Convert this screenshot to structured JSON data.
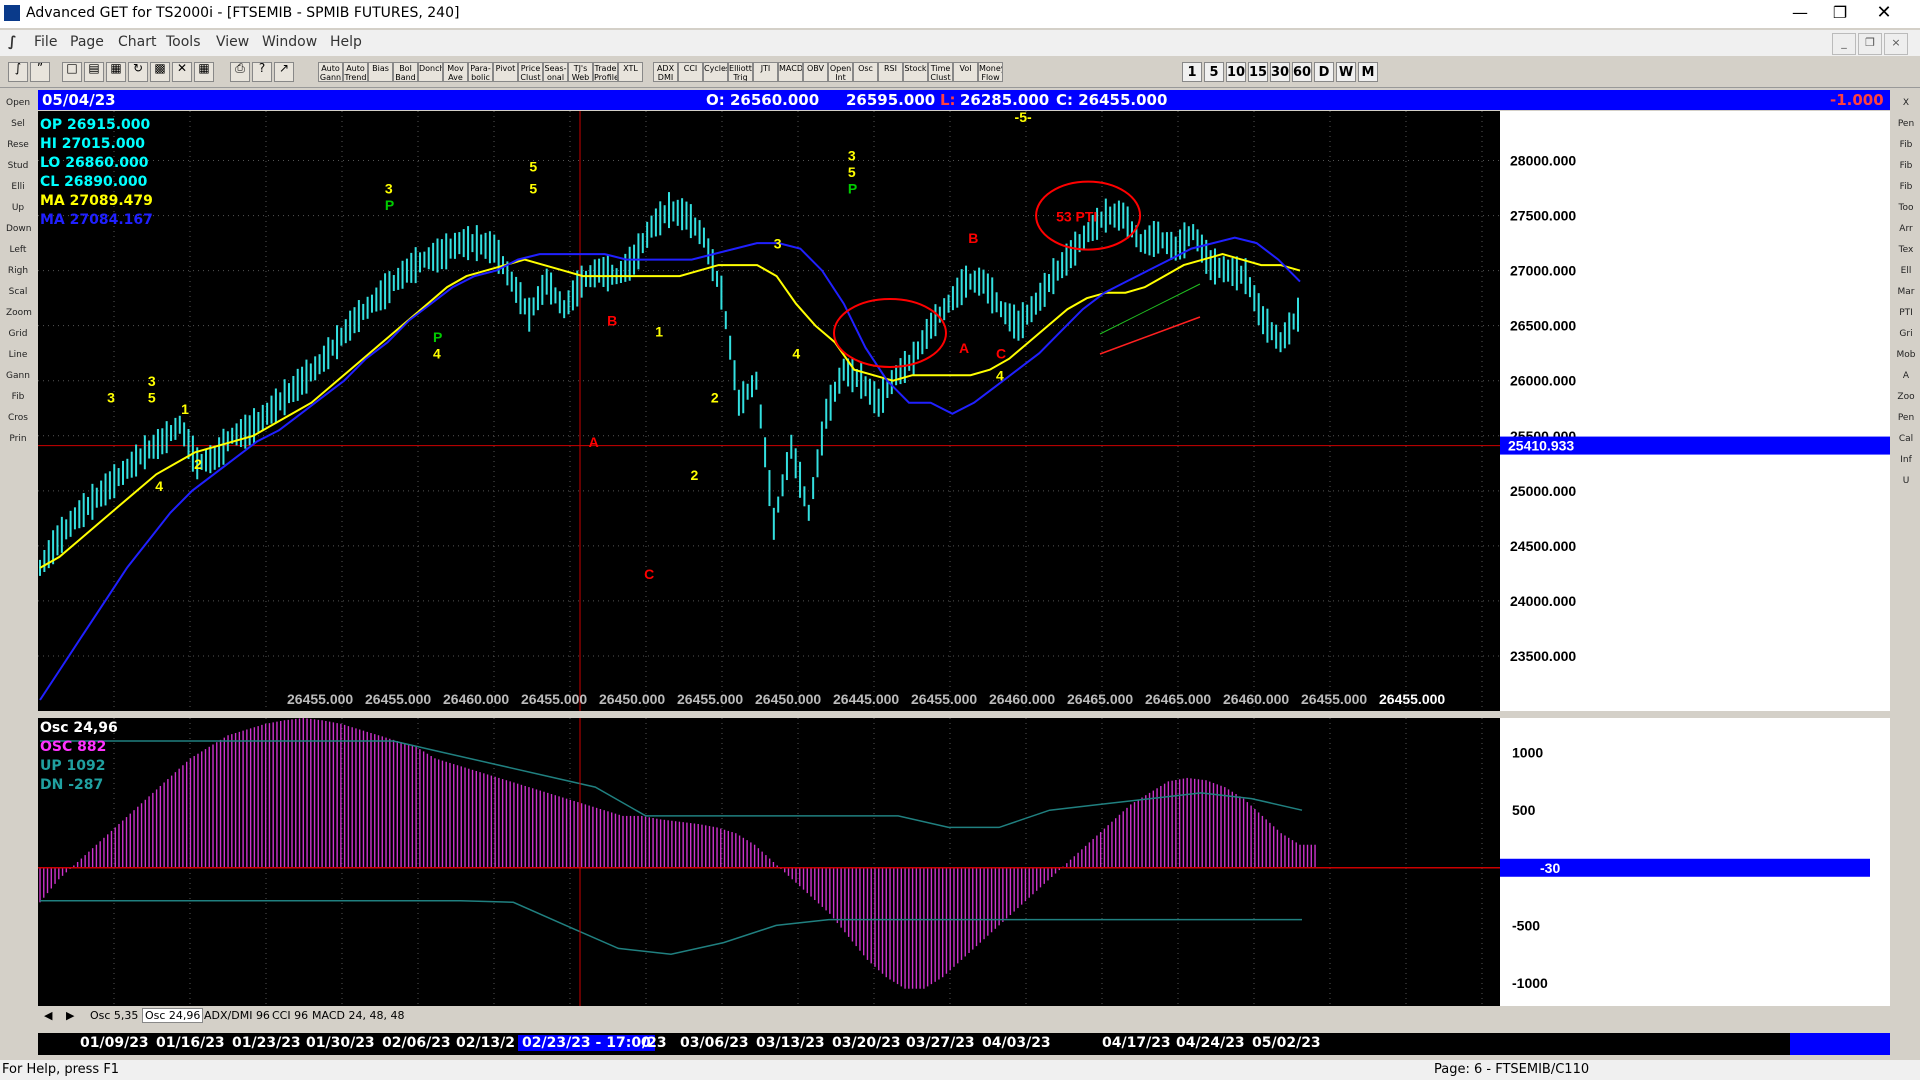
{
  "window": {
    "title": "Advanced GET for TS2000i - [FTSEMIB - SPMIB FUTURES, 240]"
  },
  "menu": [
    "File",
    "Page",
    "Chart",
    "Tools",
    "View",
    "Window",
    "Help"
  ],
  "toolbar": {
    "study_buttons": [
      "Auto Gann",
      "Auto Trend",
      "Bias",
      "Bol Band",
      "Donch",
      "Mov Ave",
      "Para-bolic",
      "Pivot",
      "Price Clust",
      "Seas-onal",
      "TJ's Web",
      "Trade Profile",
      "XTL",
      "ADX DMI",
      "CCI",
      "Cycles",
      "Elliott Trig",
      "JTI",
      "MACD",
      "OBV",
      "Open Int",
      "Osc",
      "RSI",
      "Stock",
      "Time Clust",
      "Vol",
      "Money Flow"
    ],
    "timeframes": [
      "1",
      "5",
      "10",
      "15",
      "30",
      "60",
      "D",
      "W",
      "M"
    ]
  },
  "info_bar": {
    "date": "05/04/23",
    "open": "O: 26560.000",
    "high": "26595.000",
    "low_label": "L:",
    "low": "26285.000",
    "close": "C: 26455.000",
    "change": "-1.000"
  },
  "chart_data": [
    {
      "type": "line",
      "title": "",
      "price_axis_ticks": [
        "28000.000",
        "27500.000",
        "27000.000",
        "26500.000",
        "26000.000",
        "25500.000",
        "25000.000",
        "24500.000",
        "24000.000",
        "23500.000"
      ],
      "ylim": [
        23000,
        28450
      ],
      "cursor_price": "25410.933",
      "cursor_price_value": 25410.933,
      "overlay": {
        "op": "OP  26915.000",
        "hi": "HI   27015.000",
        "lo": "LO   26860.000",
        "cl": "CL   26890.000",
        "ma1": "MA  27089.479",
        "ma2": "MA  27084.167"
      },
      "bottom_values": [
        "26455.000",
        "26455.000",
        "26460.000",
        "26455.000",
        "26450.000",
        "26455.000",
        "26450.000",
        "26445.000",
        "26455.000",
        "26460.000",
        "26465.000",
        "26465.000",
        "26460.000",
        "26455.000",
        "26455.000"
      ],
      "price_series": {
        "name": "",
        "values": [
          24300,
          24550,
          24750,
          24900,
          25050,
          25200,
          25350,
          25450,
          25600,
          25250,
          25300,
          25500,
          25550,
          25700,
          25850,
          26000,
          26150,
          26350,
          26550,
          26700,
          26850,
          27000,
          27100,
          27150,
          27250,
          27250,
          27200,
          26900,
          26600,
          26900,
          26650,
          26900,
          27000,
          26950,
          27100,
          27400,
          27550,
          27500,
          27300,
          26800,
          25800,
          26000,
          24700,
          25400,
          24800,
          25700,
          26100,
          26000,
          25800,
          26050,
          26200,
          26500,
          26700,
          26900,
          26900,
          26650,
          26500,
          26700,
          26950,
          27150,
          27350,
          27500,
          27500,
          27250,
          27300,
          27200,
          27350,
          27050,
          27000,
          26950,
          26550,
          26350,
          26600
        ]
      },
      "ma_yellow": {
        "name": "",
        "values": [
          24300,
          24400,
          24550,
          24700,
          24850,
          25000,
          25150,
          25250,
          25350,
          25400,
          25450,
          25500,
          25600,
          25700,
          25800,
          25950,
          26100,
          26250,
          26400,
          26550,
          26700,
          26850,
          26950,
          27000,
          27050,
          27100,
          27050,
          27000,
          26950,
          26950,
          26950,
          26950,
          26950,
          26950,
          27000,
          27050,
          27050,
          27050,
          26950,
          26700,
          26500,
          26350,
          26100,
          26050,
          26000,
          26050,
          26050,
          26050,
          26050,
          26100,
          26200,
          26350,
          26500,
          26650,
          26750,
          26800,
          26800,
          26850,
          26950,
          27050,
          27100,
          27150,
          27100,
          27050,
          27050,
          27000
        ]
      },
      "ma_blue": {
        "name": "",
        "values": [
          23100,
          23400,
          23700,
          24000,
          24300,
          24550,
          24800,
          25000,
          25150,
          25300,
          25450,
          25550,
          25700,
          25850,
          26000,
          26200,
          26350,
          26550,
          26700,
          26850,
          26950,
          27000,
          27100,
          27150,
          27150,
          27150,
          27150,
          27100,
          27100,
          27100,
          27100,
          27150,
          27200,
          27250,
          27250,
          27200,
          27000,
          26700,
          26300,
          26000,
          25800,
          25800,
          25700,
          25800,
          25950,
          26100,
          26250,
          26450,
          26650,
          26800,
          26900,
          27000,
          27100,
          27200,
          27250,
          27300,
          27250,
          27100,
          26900
        ]
      },
      "labels": [
        {
          "text": "3",
          "color": "#ffff00",
          "x": 0.04,
          "y": 25800
        },
        {
          "text": "3",
          "color": "#ffff00",
          "x": 0.062,
          "y": 25950
        },
        {
          "text": "5",
          "color": "#ffff00",
          "x": 0.062,
          "y": 25800
        },
        {
          "text": "4",
          "color": "#ffff00",
          "x": 0.066,
          "y": 25000
        },
        {
          "text": "1",
          "color": "#ffff00",
          "x": 0.08,
          "y": 25700
        },
        {
          "text": "2",
          "color": "#ffff00",
          "x": 0.087,
          "y": 25200
        },
        {
          "text": "3",
          "color": "#ffff00",
          "x": 0.19,
          "y": 27700
        },
        {
          "text": "P",
          "color": "#00cc00",
          "x": 0.19,
          "y": 27550
        },
        {
          "text": "P",
          "color": "#00cc00",
          "x": 0.216,
          "y": 26350
        },
        {
          "text": "4",
          "color": "#ffff00",
          "x": 0.216,
          "y": 26200
        },
        {
          "text": "5",
          "color": "#ffff00",
          "x": 0.268,
          "y": 27900
        },
        {
          "text": "5",
          "color": "#ffff00",
          "x": 0.268,
          "y": 27700
        },
        {
          "text": "B",
          "color": "#ff0000",
          "x": 0.31,
          "y": 26500
        },
        {
          "text": "A",
          "color": "#ff0000",
          "x": 0.3,
          "y": 25400
        },
        {
          "text": "C",
          "color": "#ff0000",
          "x": 0.33,
          "y": 24200
        },
        {
          "text": "1",
          "color": "#ffff00",
          "x": 0.336,
          "y": 26400
        },
        {
          "text": "2",
          "color": "#ffff00",
          "x": 0.355,
          "y": 25100
        },
        {
          "text": "2",
          "color": "#ffff00",
          "x": 0.366,
          "y": 25800
        },
        {
          "text": "3",
          "color": "#ffff00",
          "x": 0.4,
          "y": 27200
        },
        {
          "text": "4",
          "color": "#ffff00",
          "x": 0.41,
          "y": 26200
        },
        {
          "text": "3",
          "color": "#ffff00",
          "x": 0.44,
          "y": 28000
        },
        {
          "text": "5",
          "color": "#ffff00",
          "x": 0.44,
          "y": 27850
        },
        {
          "text": "P",
          "color": "#00cc00",
          "x": 0.44,
          "y": 27700
        },
        {
          "text": "B",
          "color": "#ff0000",
          "x": 0.505,
          "y": 27250
        },
        {
          "text": "A",
          "color": "#ff0000",
          "x": 0.5,
          "y": 26250
        },
        {
          "text": "C",
          "color": "#ff0000",
          "x": 0.52,
          "y": 26200
        },
        {
          "text": "4",
          "color": "#ffff00",
          "x": 0.52,
          "y": 26000
        },
        {
          "text": "-5-",
          "color": "#ffff00",
          "x": 0.53,
          "y": 28350
        },
        {
          "text": "53 PTI",
          "color": "#ff0000",
          "x": 0.54,
          "y": 27500
        }
      ]
    },
    {
      "type": "bar",
      "title": "Osc 24,96",
      "overlay": {
        "osc": "OSC 882",
        "up": "UP   1092",
        "dn": "DN   -287"
      },
      "axis_ticks": [
        "1000",
        "500",
        "-30",
        "-500",
        "-1000"
      ],
      "ylim": [
        -1200,
        1300
      ],
      "current": "-30",
      "values": [
        -300,
        -100,
        50,
        200,
        350,
        500,
        650,
        800,
        950,
        1050,
        1150,
        1200,
        1250,
        1280,
        1300,
        1280,
        1250,
        1200,
        1150,
        1100,
        1050,
        950,
        900,
        850,
        800,
        750,
        700,
        650,
        600,
        550,
        500,
        450,
        450,
        420,
        400,
        380,
        350,
        300,
        200,
        50,
        -100,
        -250,
        -400,
        -600,
        -800,
        -950,
        -1050,
        -1050,
        -950,
        -800,
        -650,
        -500,
        -350,
        -200,
        -50,
        100,
        250,
        400,
        550,
        650,
        750,
        780,
        760,
        700,
        600,
        450,
        300,
        200
      ],
      "up_band": [
        1100,
        1100,
        1100,
        1100,
        1100,
        1100,
        1100,
        1100,
        1000,
        900,
        800,
        700,
        450,
        450,
        450,
        450,
        450,
        450,
        350,
        350,
        500,
        550,
        600,
        650,
        600,
        500
      ],
      "dn_band": [
        -287,
        -287,
        -287,
        -287,
        -287,
        -287,
        -287,
        -287,
        -287,
        -300,
        -500,
        -700,
        -750,
        -650,
        -500,
        -450,
        -450,
        -450,
        -450,
        -450,
        -450,
        -450,
        -450,
        -450,
        -450
      ]
    }
  ],
  "sub_tabs": [
    "Osc 5,35",
    "Osc 24,96",
    "ADX/DMI 96",
    "CCI 96",
    "MACD 24, 48, 48"
  ],
  "date_axis": [
    "01/09/23",
    "01/16/23",
    "01/23/23",
    "01/30/23",
    "02/06/23",
    "02/13/2",
    "02/23/23 - 17:00",
    "/23",
    "03/06/23",
    "03/13/23",
    "03/20/23",
    "03/27/23",
    "04/03/23",
    "04/17/23",
    "04/24/23",
    "05/02/23"
  ],
  "status": {
    "left": "For Help, press F1",
    "right": "Page: 6 - FTSEMIB/C110"
  },
  "left_tools": [
    "Open",
    "Sel",
    "Reset",
    "Study",
    "Elliott",
    "Up",
    "Down",
    "Left",
    "Right",
    "Scale",
    "Zoom",
    "Grid",
    "Lines",
    "Gann",
    "Fib",
    "Cross",
    "Print"
  ],
  "right_tools": [
    "X",
    "Pen",
    "Fib Ret",
    "Fib Time",
    "Fib Ext",
    "Tools",
    "Arrow",
    "Text",
    "Ellipse",
    "Mark",
    "PTI",
    "Grid",
    "Mob",
    "A",
    "Zoom",
    "Pen2",
    "Cal",
    "Info",
    "U"
  ],
  "colors": {
    "price": "#33e0e0",
    "ma_yellow": "#ffff00",
    "ma_blue": "#2020ff",
    "osc": "#cc33cc",
    "band": "#208080",
    "crosshair": "#cc0000",
    "info_bg": "#0000ff"
  }
}
